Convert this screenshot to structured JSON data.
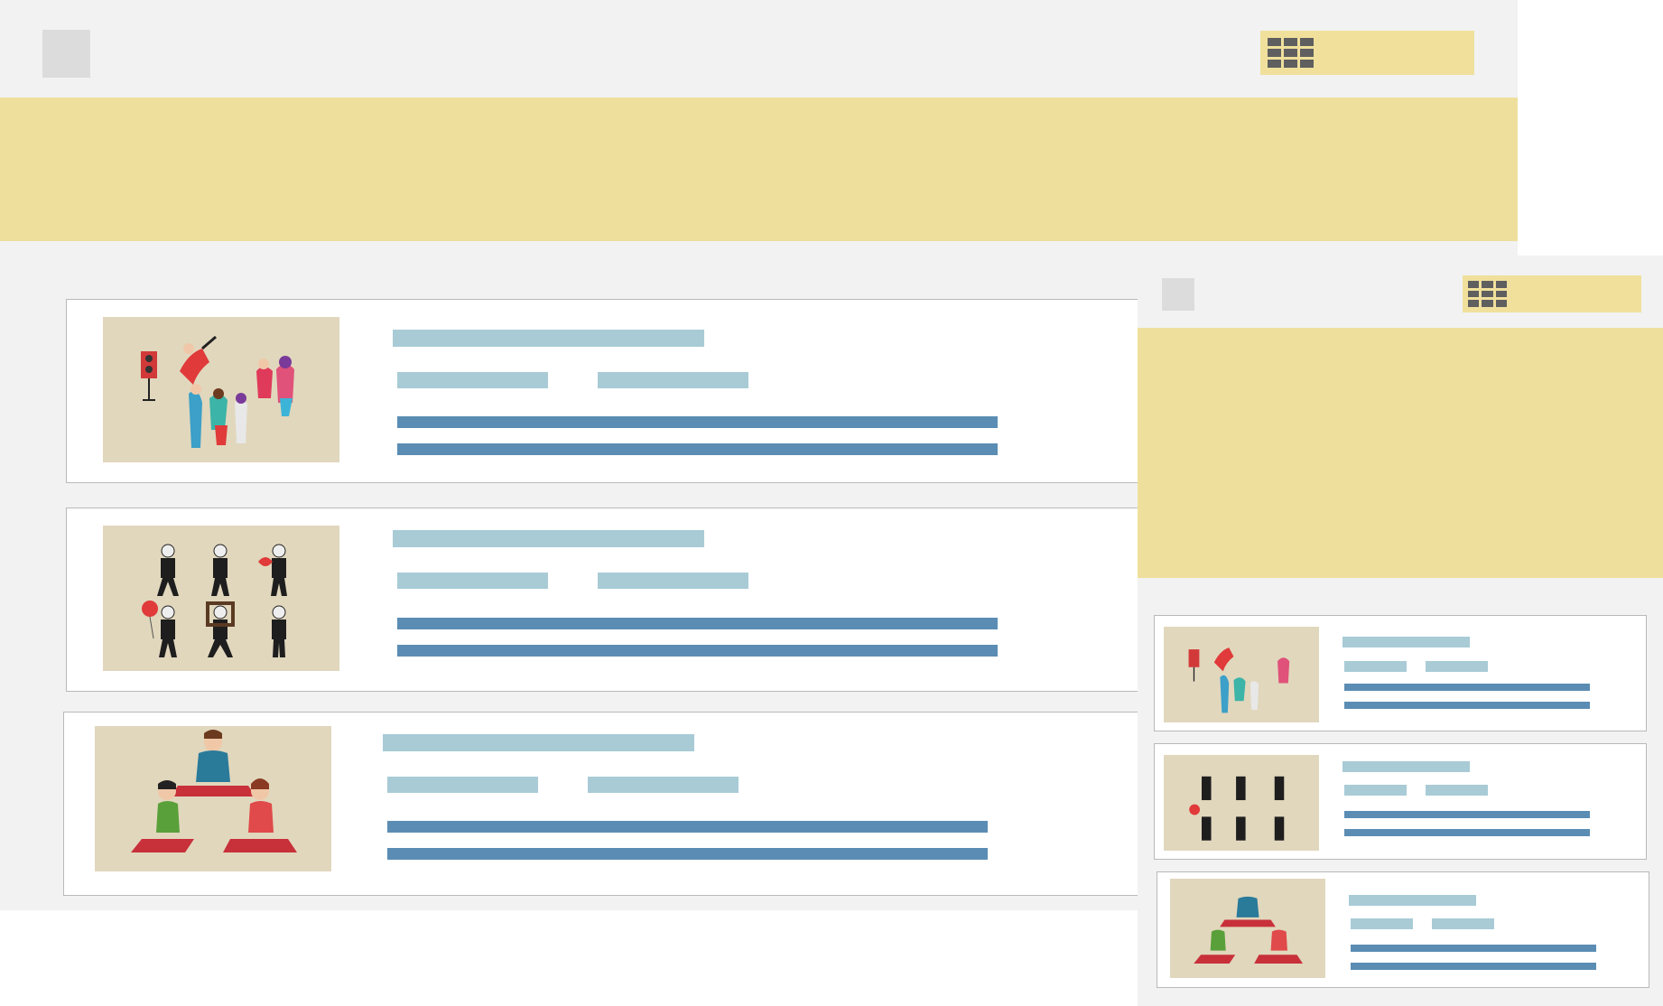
{
  "desktop_view": {
    "menu_icon": "grid-icon",
    "cards": [
      {
        "name": "card-party",
        "illustration": "party-people-illustration"
      },
      {
        "name": "card-mimes",
        "illustration": "mimes-illustration"
      },
      {
        "name": "card-yoga",
        "illustration": "yoga-class-illustration"
      }
    ]
  },
  "mobile_view": {
    "menu_icon": "grid-icon",
    "cards": [
      {
        "name": "card-party",
        "illustration": "party-people-illustration"
      },
      {
        "name": "card-mimes",
        "illustration": "mimes-illustration"
      },
      {
        "name": "card-yoga",
        "illustration": "yoga-class-illustration"
      }
    ]
  },
  "colors": {
    "background": "#f2f2f2",
    "accent_yellow": "#efdf9c",
    "placeholder_light_blue": "#a8cbd6",
    "placeholder_dark_blue": "#5b8db4",
    "thumbnail_beige": "#e1d7bd"
  }
}
